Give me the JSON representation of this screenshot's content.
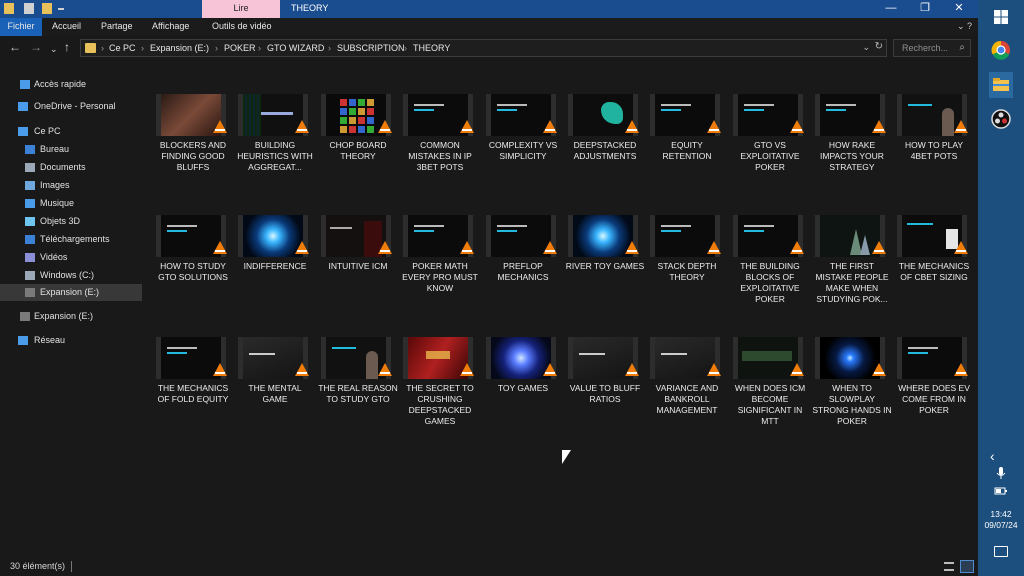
{
  "titlebar": {
    "contextual_tab": "Lire",
    "title": "THEORY",
    "minimize": "—",
    "maximize": "❐",
    "close": "✕"
  },
  "ribbon": {
    "tabs": [
      "Fichier",
      "Accueil",
      "Partage",
      "Affichage",
      "Outils de vidéo"
    ],
    "collapse": "⌄ ?"
  },
  "address": {
    "crumbs": [
      "Ce PC",
      "Expansion (E:)",
      "POKER",
      "GTO WIZARD",
      "SUBSCRIPTION",
      "THEORY"
    ],
    "search_placeholder": "Recherch...",
    "back": "←",
    "forward": "→",
    "recent": "⌄",
    "up": "↑",
    "dropdown": "⌄",
    "refresh": "↻",
    "search_icon": "⌕"
  },
  "sidebar": {
    "items": [
      {
        "label": "Accès rapide",
        "icon": "star-icon",
        "color": "#4a9be8"
      },
      {
        "label": "OneDrive - Personal",
        "icon": "cloud-icon",
        "color": "#4a9be8"
      },
      {
        "label": "Ce PC",
        "icon": "computer-icon",
        "color": "#4a9be8"
      },
      {
        "label": "Bureau",
        "icon": "desktop-icon",
        "color": "#3b82d6"
      },
      {
        "label": "Documents",
        "icon": "documents-icon",
        "color": "#9aa8b8"
      },
      {
        "label": "Images",
        "icon": "images-icon",
        "color": "#6fa8dc"
      },
      {
        "label": "Musique",
        "icon": "music-icon",
        "color": "#4a9be8"
      },
      {
        "label": "Objets 3D",
        "icon": "cube-icon",
        "color": "#6ec6f0"
      },
      {
        "label": "Téléchargements",
        "icon": "download-icon",
        "color": "#3b82d6"
      },
      {
        "label": "Vidéos",
        "icon": "video-icon",
        "color": "#8a8fd6"
      },
      {
        "label": "Windows (C:)",
        "icon": "drive-icon",
        "color": "#9aa8b8"
      },
      {
        "label": "Expansion (E:)",
        "icon": "drive-icon",
        "color": "#7a7a7a"
      },
      {
        "label": "Expansion (E:)",
        "icon": "drive-icon",
        "color": "#7a7a7a"
      },
      {
        "label": "Réseau",
        "icon": "network-icon",
        "color": "#4a9be8"
      }
    ]
  },
  "files": [
    {
      "name": "BLOCKERS AND FINDING GOOD BLUFFS",
      "art": "photo-hands"
    },
    {
      "name": "BUILDING HEURISTICS WITH AGGREGAT...",
      "art": "slide-text"
    },
    {
      "name": "CHOP BOARD THEORY",
      "art": "grid-cards"
    },
    {
      "name": "COMMON MISTAKES IN IP 3BET POTS",
      "art": "slide-dark"
    },
    {
      "name": "COMPLEXITY VS SIMPLICITY",
      "art": "slide-dark"
    },
    {
      "name": "DEEPSTACKED ADJUSTMENTS",
      "art": "teal-shape"
    },
    {
      "name": "EQUITY RETENTION",
      "art": "slide-dark"
    },
    {
      "name": "GTO VS EXPLOITATIVE POKER",
      "art": "slide-dark"
    },
    {
      "name": "HOW RAKE IMPACTS YOUR STRATEGY",
      "art": "slide-dark"
    },
    {
      "name": "HOW TO PLAY 4BET POTS",
      "art": "slide-person"
    },
    {
      "name": "HOW TO STUDY GTO SOLUTIONS",
      "art": "slide-dark"
    },
    {
      "name": "INDIFFERENCE",
      "art": "blue-burst"
    },
    {
      "name": "INTUITIVE ICM",
      "art": "slide-red"
    },
    {
      "name": "POKER MATH EVERY PRO MUST KNOW",
      "art": "slide-dark"
    },
    {
      "name": "PREFLOP MECHANICS",
      "art": "slide-dark"
    },
    {
      "name": "RIVER TOY GAMES",
      "art": "blue-burst"
    },
    {
      "name": "STACK DEPTH THEORY",
      "art": "slide-dark"
    },
    {
      "name": "THE BUILDING BLOCKS OF EXPLOITATIVE POKER",
      "art": "slide-dark"
    },
    {
      "name": "THE FIRST MISTAKE PEOPLE MAKE WHEN STUDYING POK...",
      "art": "slide-chart"
    },
    {
      "name": "THE MECHANICS OF CBET SIZING",
      "art": "slide-panel"
    },
    {
      "name": "THE MECHANICS OF FOLD EQUITY",
      "art": "slide-dark"
    },
    {
      "name": "THE MENTAL GAME",
      "art": "slide-grey"
    },
    {
      "name": "THE REAL REASON TO STUDY GTO",
      "art": "slide-person"
    },
    {
      "name": "THE SECRET TO CRUSHING DEEPSTACKED GAMES",
      "art": "red-poster"
    },
    {
      "name": "TOY GAMES",
      "art": "blue-orb"
    },
    {
      "name": "VALUE TO BLUFF RATIOS",
      "art": "slide-grey"
    },
    {
      "name": "VARIANCE AND BANKROLL MANAGEMENT",
      "art": "slide-grey"
    },
    {
      "name": "WHEN DOES ICM BECOME SIGNIFICANT IN MTT",
      "art": "slide-green"
    },
    {
      "name": "WHEN TO SLOWPLAY STRONG HANDS IN POKER",
      "art": "blue-glow"
    },
    {
      "name": "WHERE DOES EV COME FROM IN POKER",
      "art": "slide-dark"
    }
  ],
  "status": {
    "count": "30 élément(s)"
  },
  "taskbar": {
    "time": "13:42",
    "date": "09/07/24",
    "chevron": "‹",
    "colors": {
      "bg": "#1c4f7d",
      "active": "#2b6aa0"
    }
  }
}
